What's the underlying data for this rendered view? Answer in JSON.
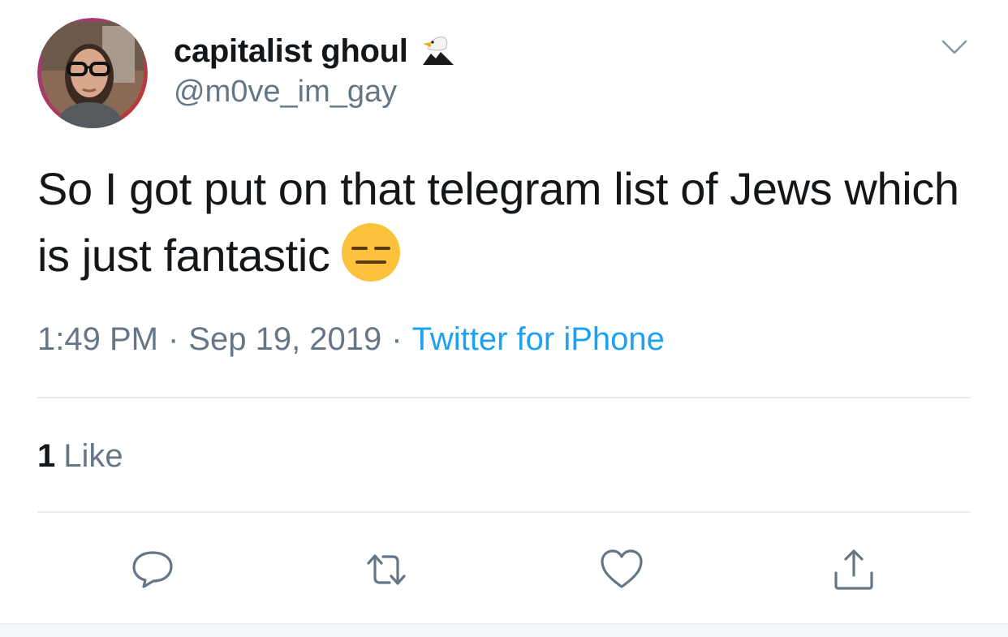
{
  "author": {
    "display_name": "capitalist ghoul",
    "name_emoji": "eagle-emoji",
    "handle": "@m0ve_im_gay"
  },
  "tweet": {
    "text": "So I got put on that telegram list of Jews which is just fantastic",
    "trailing_emoji": "expressionless-face-emoji"
  },
  "meta": {
    "time": "1:49 PM",
    "separator": "·",
    "date": "Sep 19, 2019",
    "source": "Twitter for iPhone"
  },
  "engagement": {
    "like_count": "1",
    "like_label": "Like"
  },
  "icons": {
    "caret": "chevron-down-icon",
    "reply": "reply-icon",
    "retweet": "retweet-icon",
    "like": "heart-icon",
    "share": "share-icon"
  },
  "colors": {
    "text": "#14171a",
    "secondary": "#657786",
    "link": "#1da1f2",
    "divider": "#e6ecf0"
  }
}
